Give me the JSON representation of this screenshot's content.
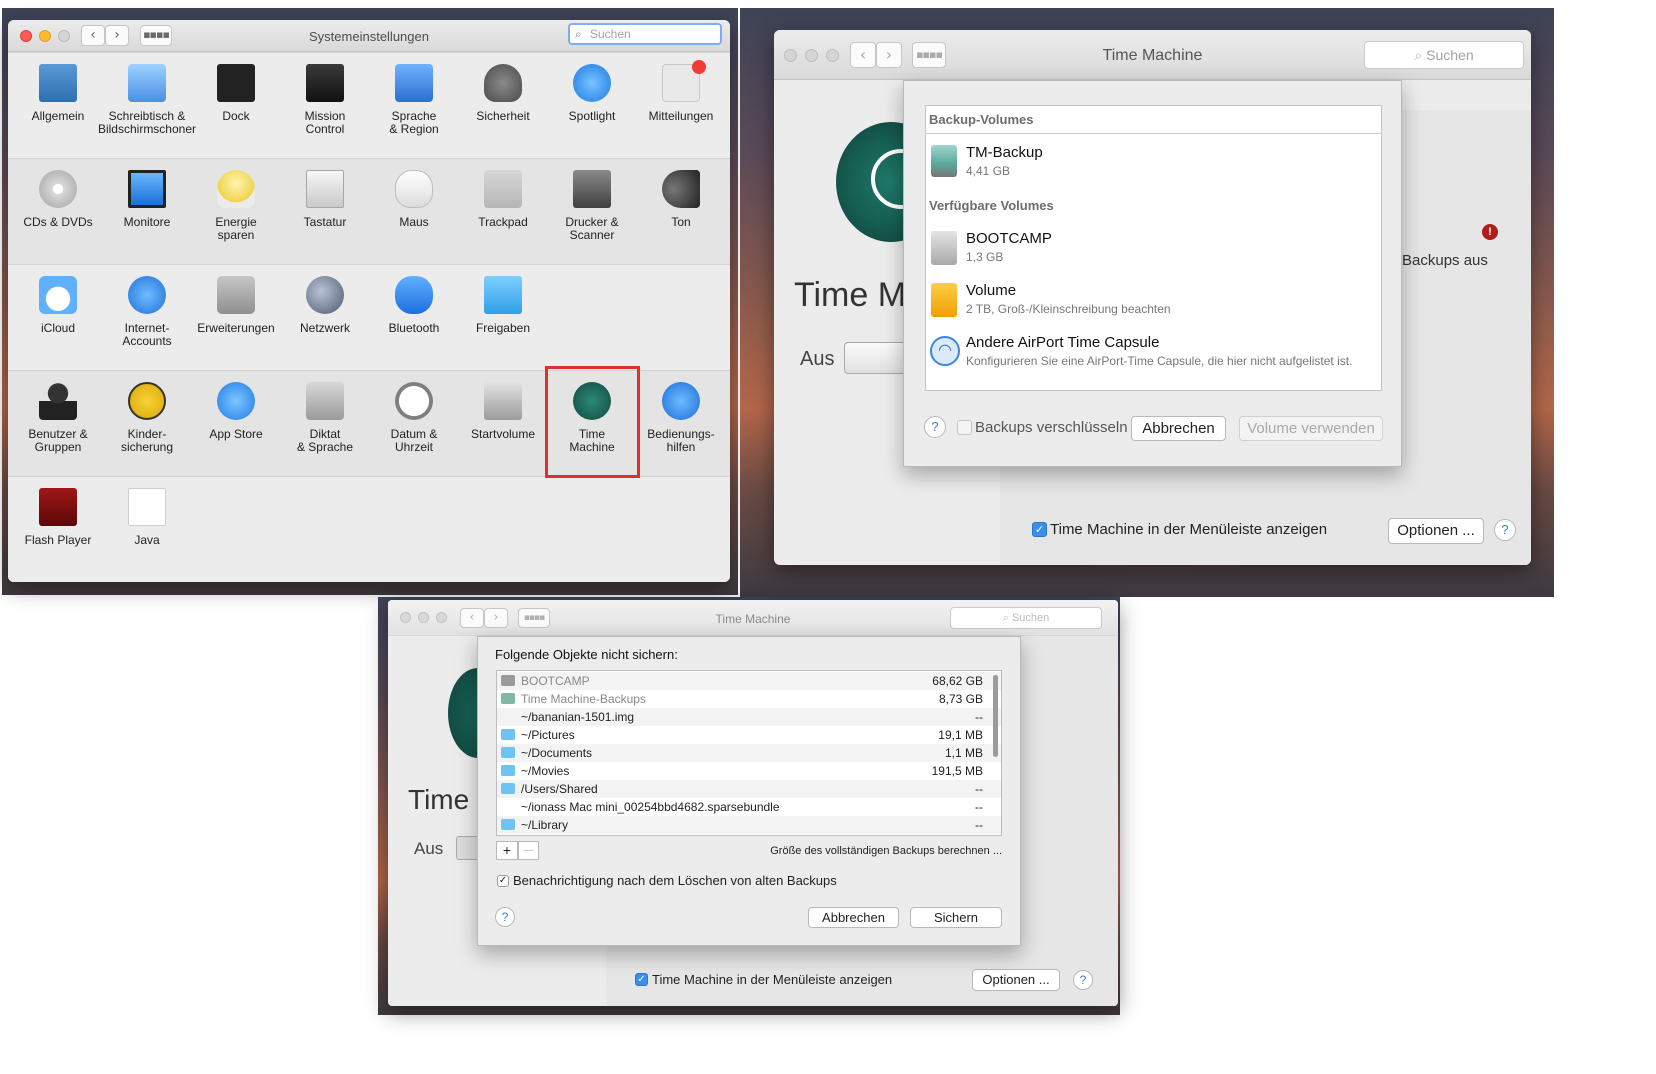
{
  "sysprefs": {
    "title": "Systemeinstellungen",
    "search_placeholder": "Suchen",
    "rows": [
      [
        {
          "label": "Allgemein",
          "icon": "general-icon"
        },
        {
          "label": "Schreibtisch &\nBildschirmschoner",
          "icon": "desktop-screensaver-icon"
        },
        {
          "label": "Dock",
          "icon": "dock-icon"
        },
        {
          "label": "Mission\nControl",
          "icon": "mission-control-icon"
        },
        {
          "label": "Sprache\n& Region",
          "icon": "language-region-icon"
        },
        {
          "label": "Sicherheit",
          "icon": "security-icon"
        },
        {
          "label": "Spotlight",
          "icon": "spotlight-icon"
        },
        {
          "label": "Mitteilungen",
          "icon": "notifications-icon"
        }
      ],
      [
        {
          "label": "CDs & DVDs",
          "icon": "cd-dvd-icon"
        },
        {
          "label": "Monitore",
          "icon": "displays-icon"
        },
        {
          "label": "Energie\nsparen",
          "icon": "energy-saver-icon"
        },
        {
          "label": "Tastatur",
          "icon": "keyboard-icon"
        },
        {
          "label": "Maus",
          "icon": "mouse-icon"
        },
        {
          "label": "Trackpad",
          "icon": "trackpad-icon"
        },
        {
          "label": "Drucker &\nScanner",
          "icon": "printer-scanner-icon"
        },
        {
          "label": "Ton",
          "icon": "sound-icon"
        }
      ],
      [
        {
          "label": "iCloud",
          "icon": "icloud-icon"
        },
        {
          "label": "Internet-\nAccounts",
          "icon": "internet-accounts-icon"
        },
        {
          "label": "Erweiterungen",
          "icon": "extensions-icon"
        },
        {
          "label": "Netzwerk",
          "icon": "network-icon"
        },
        {
          "label": "Bluetooth",
          "icon": "bluetooth-icon"
        },
        {
          "label": "Freigaben",
          "icon": "sharing-icon"
        }
      ],
      [
        {
          "label": "Benutzer &\nGruppen",
          "icon": "users-groups-icon"
        },
        {
          "label": "Kinder-\nsicherung",
          "icon": "parental-controls-icon"
        },
        {
          "label": "App Store",
          "icon": "app-store-icon"
        },
        {
          "label": "Diktat\n& Sprache",
          "icon": "dictation-speech-icon"
        },
        {
          "label": "Datum &\nUhrzeit",
          "icon": "date-time-icon"
        },
        {
          "label": "Startvolume",
          "icon": "startup-disk-icon"
        },
        {
          "label": "Time\nMachine",
          "icon": "time-machine-icon"
        },
        {
          "label": "Bedienungs-\nhilfen",
          "icon": "accessibility-icon"
        }
      ],
      [
        {
          "label": "Flash Player",
          "icon": "flash-player-icon"
        },
        {
          "label": "Java",
          "icon": "java-icon"
        }
      ]
    ],
    "highlight_color": "#e0302b"
  },
  "tm1": {
    "title": "Time Machine",
    "search_placeholder": "Suchen",
    "bg_title": "Time Ma",
    "bg_switch": "Aus",
    "bg_status": "Backups aus",
    "sheet": {
      "section_backup": "Backup-Volumes",
      "section_available": "Verfügbare Volumes",
      "volumes": [
        {
          "name": "TM-Backup",
          "detail": "4,41 GB",
          "icon": "time-machine-disk-icon"
        },
        {
          "name": "BOOTCAMP",
          "detail": "1,3 GB",
          "icon": "internal-disk-icon"
        },
        {
          "name": "Volume",
          "detail": "2 TB, Groß-/Kleinschreibung beachten",
          "icon": "external-disk-icon"
        },
        {
          "name": "Andere AirPort Time Capsule",
          "detail": "Konfigurieren Sie eine AirPort-Time Capsule, die hier nicht aufgelistet ist.",
          "icon": "airport-wifi-icon"
        }
      ],
      "help": "?",
      "encrypt_label": "Backups verschlüsseln",
      "cancel": "Abbrechen",
      "use": "Volume verwenden"
    },
    "menubar_label": "Time Machine in der Menüleiste anzeigen",
    "options": "Optionen ...",
    "help": "?"
  },
  "tm2": {
    "title": "Time Machine",
    "search_placeholder": "Suchen",
    "bg_title": "Time",
    "bg_switch": "Aus",
    "sheet": {
      "heading": "Folgende Objekte nicht sichern:",
      "items": [
        {
          "name": "BOOTCAMP",
          "size": "68,62 GB",
          "icon": "disk-icon",
          "dim": true
        },
        {
          "name": "Time Machine-Backups",
          "size": "8,73 GB",
          "icon": "tm-disk-icon",
          "dim": true
        },
        {
          "name": "~/bananian-1501.img",
          "size": "--",
          "icon": "none",
          "dim": false
        },
        {
          "name": "~/Pictures",
          "size": "19,1 MB",
          "icon": "folder-icon",
          "dim": false
        },
        {
          "name": "~/Documents",
          "size": "1,1 MB",
          "icon": "folder-icon",
          "dim": false
        },
        {
          "name": "~/Movies",
          "size": "191,5 MB",
          "icon": "folder-icon",
          "dim": false
        },
        {
          "name": "/Users/Shared",
          "size": "--",
          "icon": "folder-icon",
          "dim": false
        },
        {
          "name": "~/ionass Mac mini_00254bbd4682.sparsebundle",
          "size": "--",
          "icon": "none",
          "dim": false
        },
        {
          "name": "~/Library",
          "size": "--",
          "icon": "folder-icon",
          "dim": false
        }
      ],
      "add": "+",
      "remove": "—",
      "calc_link": "Größe des vollständigen Backups berechnen ...",
      "notify_label": "Benachrichtigung nach dem Löschen von alten Backups",
      "help": "?",
      "cancel": "Abbrechen",
      "save": "Sichern"
    },
    "menubar_label": "Time Machine in der Menüleiste anzeigen",
    "options": "Optionen ...",
    "help": "?"
  }
}
